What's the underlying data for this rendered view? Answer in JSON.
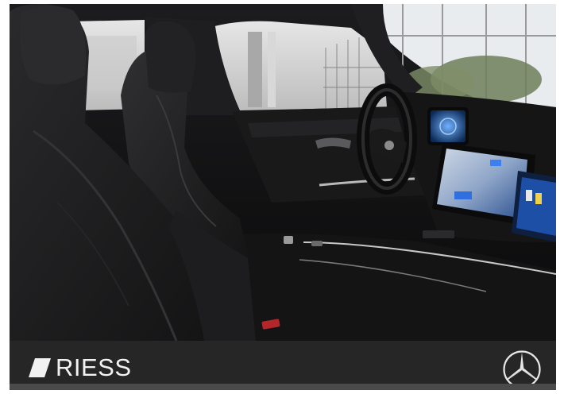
{
  "image": {
    "subject": "car-interior-front-seats-dashboard",
    "colors": {
      "upholstery": "#1a1a1b",
      "ambient_trim": "#bfbfbf",
      "display_blue": "#2a6fd6",
      "brand_bar": "#262626"
    }
  },
  "footer": {
    "dealer_name": "RIESS",
    "dealer_icon": "slash-mark-icon",
    "maker_icon": "three-pointed-star-icon"
  }
}
